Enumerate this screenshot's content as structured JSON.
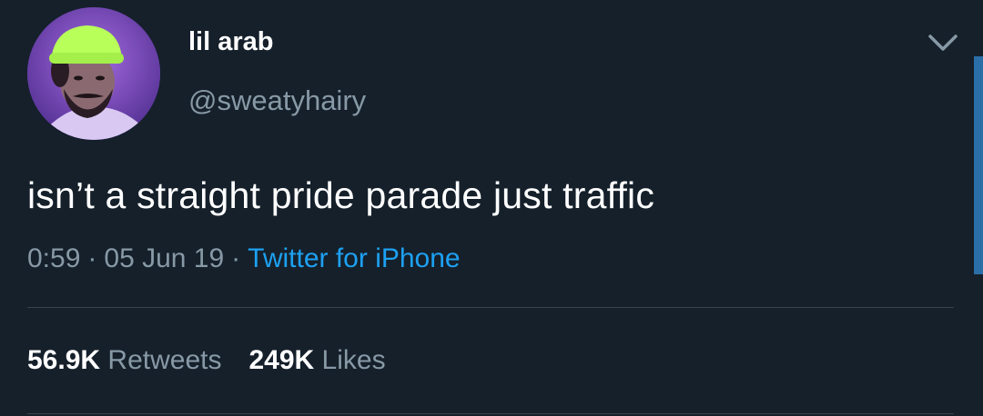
{
  "user": {
    "display_name": "lil arab",
    "handle": "@sweatyhairy"
  },
  "tweet": {
    "text": "isn’t a straight pride parade just traffic",
    "time": "0:59",
    "date": "05 Jun 19",
    "separator": "·",
    "source": "Twitter for iPhone"
  },
  "stats": {
    "retweets_count": "56.9K",
    "retweets_label": "Retweets",
    "likes_count": "249K",
    "likes_label": "Likes"
  },
  "colors": {
    "background": "#15202b",
    "text_primary": "#ffffff",
    "text_secondary": "#8899a6",
    "link": "#1da1f2",
    "divider": "#38444d"
  },
  "icons": {
    "menu": "chevron-down-icon"
  }
}
